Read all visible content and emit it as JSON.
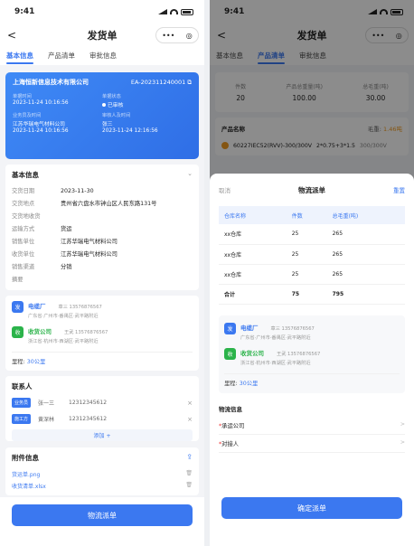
{
  "status_time": "9:41",
  "nav": {
    "back": "<",
    "title": "发货单",
    "more": "•••",
    "target": "◎"
  },
  "tabs": [
    "基本信息",
    "产品清单",
    "审批信息"
  ],
  "left": {
    "card": {
      "company": "上海恒新信息技术有限公司",
      "order_no": "EA-202311240001",
      "copy_icon": "⧉",
      "f1_label": "单据时间",
      "f1_val": "2023-11-24 10:16:56",
      "f2_label": "单据状态",
      "f2_val": "已审核",
      "f3_label": "业务员及时间",
      "f3_val": "江苏华瑞电气材料公司",
      "f3_time": "2023-11-24 10:16:56",
      "f4_label": "审核人及时间",
      "f4_val": "张三",
      "f4_time": "2023-11-24 12:16:56"
    },
    "basic": {
      "title": "基本信息",
      "rows": [
        {
          "label": "交货日期",
          "value": "2023-11-30"
        },
        {
          "label": "交货地点",
          "value": "贵州省六盘水市钟山区人民东路131号"
        },
        {
          "label": "交货地收货",
          "value": ""
        },
        {
          "label": "运输方式",
          "value": "货运"
        },
        {
          "label": "销售单位",
          "value": "江苏华瑞电气材料公司"
        },
        {
          "label": "收货单位",
          "value": "江苏华瑞电气材料公司"
        },
        {
          "label": "销售渠道",
          "value": "分销"
        },
        {
          "label": "摘要",
          "value": ""
        }
      ]
    },
    "route": {
      "from_badge": "发",
      "from_name": "电缆厂",
      "from_contact": "章三 13576876567",
      "from_addr": "广东省·广州市·番禺区·武平路附近",
      "to_badge": "收",
      "to_name": "收货公司",
      "to_contact": "王武 13576876567",
      "to_addr": "浙江省·杭州市·西湖区·武平路附近",
      "distance_label": "里程:",
      "distance_val": "30公里"
    },
    "contacts": {
      "title": "联系人",
      "rows": [
        {
          "tag": "业务员",
          "name": "张一三",
          "phone": "12312345612"
        },
        {
          "tag": "施工方",
          "name": "黄深林",
          "phone": "12312345612"
        }
      ],
      "add": "添加 +"
    },
    "files": {
      "title": "附件信息",
      "items": [
        "货运单.png",
        "收货清单.xlsx"
      ]
    },
    "button": "物流派单"
  },
  "right": {
    "summary": [
      {
        "label": "件数",
        "value": "20"
      },
      {
        "label": "产品总重量(吨)",
        "value": "100.00"
      },
      {
        "label": "总毛重(吨)",
        "value": "30.00"
      }
    ],
    "product": {
      "title": "产品名称",
      "mz_label": "毛重:",
      "mz_val": "1.46吨",
      "name": "60227IEC52(RVV)-300/300V",
      "spec": "2*0.75+3*1.5",
      "voltage": "300/300V"
    },
    "sheet": {
      "cancel": "取消",
      "title": "物流派单",
      "reset": "重置",
      "headers": [
        "仓库名称",
        "件数",
        "总毛重(吨)"
      ],
      "rows": [
        [
          "xx仓库",
          "25",
          "265"
        ],
        [
          "xx仓库",
          "25",
          "265"
        ],
        [
          "xx仓库",
          "25",
          "265"
        ],
        [
          "合计",
          "75",
          "795"
        ]
      ],
      "logistics_title": "物流信息",
      "carrier": "承运公司",
      "contact": "对接人",
      "arrow": ">",
      "button": "确定派单"
    }
  }
}
